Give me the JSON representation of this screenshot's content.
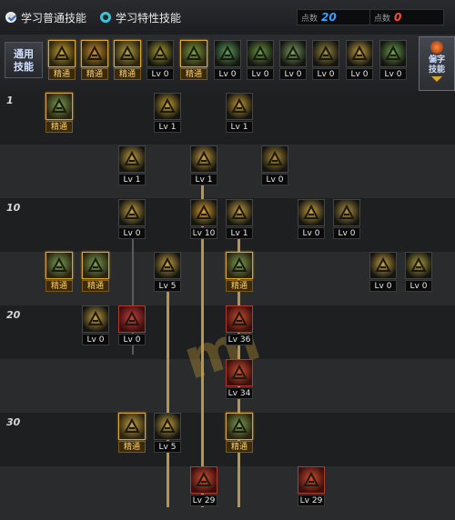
{
  "header": {
    "option_general": "学习普通技能",
    "option_special": "学习特性技能",
    "sp_label_1": "点数",
    "sp_value_1": "20",
    "sp_label_2": "点数",
    "sp_value_2": "0",
    "colors": {
      "sp1": "#3aa0ff",
      "sp2": "#ff4a3a"
    }
  },
  "iconbar": {
    "tab_general": "通用\n技能",
    "tab_mastery": "偏字\n技能",
    "skills": [
      {
        "icon": "scroll-read-icon",
        "cap": "精通",
        "style": "gold",
        "tint": "#c9a030"
      },
      {
        "icon": "cannon-icon",
        "cap": "精通",
        "style": "gold",
        "tint": "#d08a2a"
      },
      {
        "icon": "dash-icon",
        "cap": "精通",
        "style": "gold",
        "tint": "#b8a040"
      },
      {
        "icon": "wings-icon",
        "cap": "Lv 0",
        "style": "plain",
        "tint": "#b0a030"
      },
      {
        "icon": "target-icon",
        "cap": "精通",
        "style": "gold",
        "tint": "#7aa040"
      },
      {
        "icon": "crosshair-icon",
        "cap": "Lv 0",
        "style": "plain",
        "tint": "#5aa060"
      },
      {
        "icon": "runner-icon",
        "cap": "Lv 0",
        "style": "plain",
        "tint": "#6a9a40"
      },
      {
        "icon": "crouch-icon",
        "cap": "Lv 0",
        "style": "plain",
        "tint": "#78a060"
      },
      {
        "icon": "spiral-icon",
        "cap": "Lv 0",
        "style": "plain",
        "tint": "#a08a40"
      },
      {
        "icon": "muscle-icon",
        "cap": "Lv 0",
        "style": "plain",
        "tint": "#c8a040"
      },
      {
        "icon": "dna-icon",
        "cap": "Lv 0",
        "style": "plain",
        "tint": "#6aa050"
      }
    ]
  },
  "rows": {
    "levels": [
      "1",
      "10",
      "20",
      "30"
    ]
  },
  "tree": [
    {
      "id": "r1a",
      "icon": "chest-icon",
      "cap": "精通",
      "style": "gold",
      "tint": "#7aa050"
    },
    {
      "id": "r1b",
      "icon": "uppercut-icon",
      "cap": "Lv 1",
      "style": "plain",
      "tint": "#c8a030"
    },
    {
      "id": "r1c",
      "icon": "slash-icon",
      "cap": "Lv 1",
      "style": "plain",
      "tint": "#c89a30"
    },
    {
      "id": "r2a",
      "icon": "burst-icon",
      "cap": "Lv 1",
      "style": "plain",
      "tint": "#c8a040"
    },
    {
      "id": "r2b",
      "icon": "bullet-icon",
      "cap": "Lv 1",
      "style": "plain",
      "tint": "#d0a040"
    },
    {
      "id": "r2c",
      "icon": "ammo-icon",
      "cap": "Lv 0",
      "style": "plain",
      "tint": "#b08a30"
    },
    {
      "id": "r3a",
      "icon": "shield-icon",
      "cap": "Lv 0",
      "style": "plain",
      "tint": "#c8a040"
    },
    {
      "id": "r3b",
      "icon": "fire-icon",
      "cap": "Lv 10",
      "style": "plain",
      "tint": "#e0a030"
    },
    {
      "id": "r3c",
      "icon": "kick-icon",
      "cap": "Lv 1",
      "style": "plain",
      "tint": "#c8a040"
    },
    {
      "id": "r3d",
      "icon": "arrow-up-icon",
      "cap": "Lv 0",
      "style": "plain",
      "tint": "#c8a040"
    },
    {
      "id": "r3e",
      "icon": "mask-icon",
      "cap": "Lv 0",
      "style": "plain",
      "tint": "#b09040"
    },
    {
      "id": "r4a",
      "icon": "rifle-icon",
      "cap": "精通",
      "style": "gold",
      "tint": "#7aa050"
    },
    {
      "id": "r4b",
      "icon": "launcher-icon",
      "cap": "精通",
      "style": "gold",
      "tint": "#7aa050"
    },
    {
      "id": "r4c",
      "icon": "mortar-icon",
      "cap": "Lv 5",
      "style": "plain",
      "tint": "#c8a040"
    },
    {
      "id": "r4d",
      "icon": "bazooka-icon",
      "cap": "精通",
      "style": "gold",
      "tint": "#7aa050"
    },
    {
      "id": "r4e",
      "icon": "flag-icon",
      "cap": "Lv 0",
      "style": "plain",
      "tint": "#c8a040"
    },
    {
      "id": "r4f",
      "icon": "grenade-icon",
      "cap": "Lv 0",
      "style": "plain",
      "tint": "#b0a040"
    },
    {
      "id": "r5a",
      "icon": "spin-icon",
      "cap": "Lv 0",
      "style": "plain",
      "tint": "#c8a040"
    },
    {
      "id": "r5b",
      "icon": "heal-icon",
      "cap": "Lv 0",
      "style": "red",
      "tint": "#c84040"
    },
    {
      "id": "r5c",
      "icon": "eye-icon",
      "cap": "Lv 36",
      "style": "red",
      "tint": "#d05030"
    },
    {
      "id": "r6a",
      "icon": "punch-icon",
      "cap": "Lv 34",
      "style": "red",
      "tint": "#d05030"
    },
    {
      "id": "r7a",
      "icon": "cannon-shot-icon",
      "cap": "精通",
      "style": "gold",
      "tint": "#c8a040"
    },
    {
      "id": "r7b",
      "icon": "gun-icon",
      "cap": "Lv 5",
      "style": "plain",
      "tint": "#c8a040"
    },
    {
      "id": "r7c",
      "icon": "explosion-icon",
      "cap": "精通",
      "style": "gold",
      "tint": "#7aa050"
    },
    {
      "id": "r8a",
      "icon": "blast-icon",
      "cap": "Lv 29",
      "style": "red",
      "tint": "#d05030"
    },
    {
      "id": "r8b",
      "icon": "whirl-icon",
      "cap": "Lv 29",
      "style": "red",
      "tint": "#d05030"
    }
  ]
}
